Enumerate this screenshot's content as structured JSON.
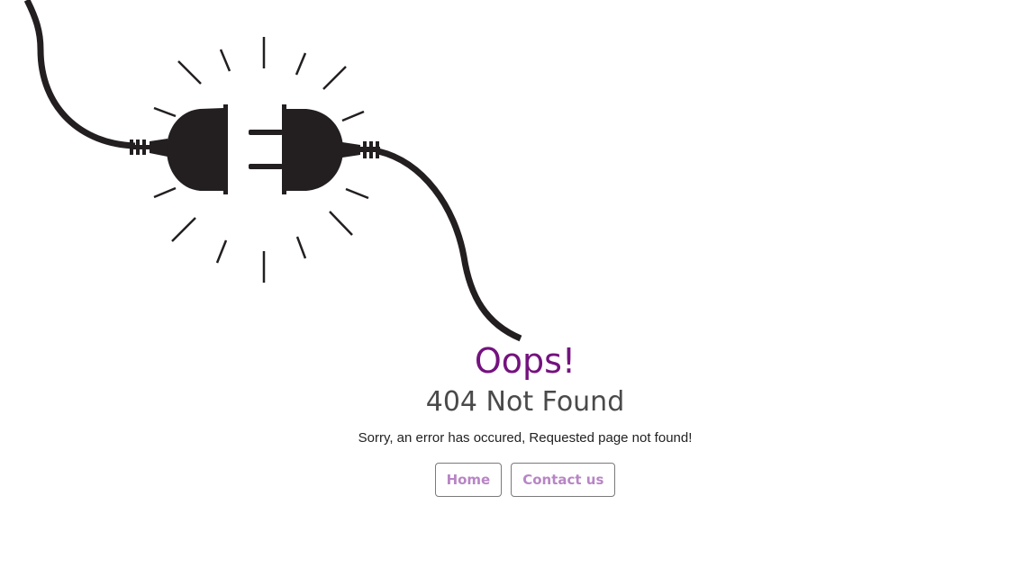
{
  "error": {
    "headline": "Oops!",
    "code_text": "404 Not Found",
    "message": "Sorry, an error has occured, Requested page not found!"
  },
  "actions": {
    "home_label": "Home",
    "contact_label": "Contact us"
  },
  "icons": {
    "illustration": "unplugged-cable-icon"
  },
  "colors": {
    "headline": "#74127e",
    "code_text": "#4a4a4a",
    "button_text": "#b885c5",
    "illustration": "#231f20"
  }
}
